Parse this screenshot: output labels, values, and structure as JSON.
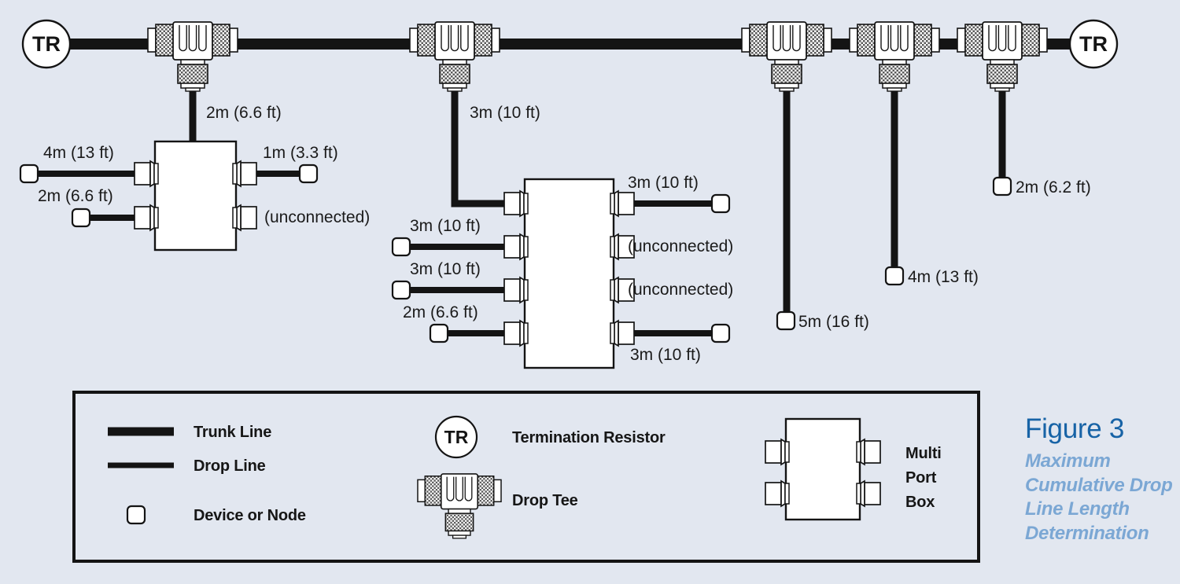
{
  "figure": {
    "number_label": "Figure 3",
    "subtitle": "Maximum Cumulative Drop Line Length Determination",
    "title_color": "#1763a6",
    "subtitle_color": "#7ba7d4",
    "background_color": "#e2e7f0",
    "line_color": "#141414"
  },
  "terminators": {
    "left_label": "TR",
    "right_label": "TR"
  },
  "drop_lengths": {
    "tee1_drop": "2m (6.6 ft)",
    "tee2_drop": "3m (10 ft)",
    "tee3_drop": "5m (16 ft)",
    "tee4_drop": "4m (13 ft)",
    "tee5_drop": "2m (6.2 ft)"
  },
  "box1": {
    "left_ports": [
      "4m (13 ft)",
      "2m (6.6 ft)"
    ],
    "right_ports": [
      "1m (3.3 ft)",
      "(unconnected)"
    ]
  },
  "box2": {
    "left_ports": [
      "3m (10 ft)",
      "3m (10 ft)",
      "2m (6.6 ft)"
    ],
    "right_ports": [
      "3m (10 ft)",
      "(unconnected)",
      "(unconnected)",
      "3m (10 ft)"
    ]
  },
  "legend": {
    "trunk_line": "Trunk Line",
    "drop_line": "Drop Line",
    "device_or_node": "Device or Node",
    "termination_resistor": "Termination Resistor",
    "termination_resistor_symbol": "TR",
    "drop_tee": "Drop Tee",
    "multi_port_box_line1": "Multi",
    "multi_port_box_line2": "Port",
    "multi_port_box_line3": "Box"
  }
}
